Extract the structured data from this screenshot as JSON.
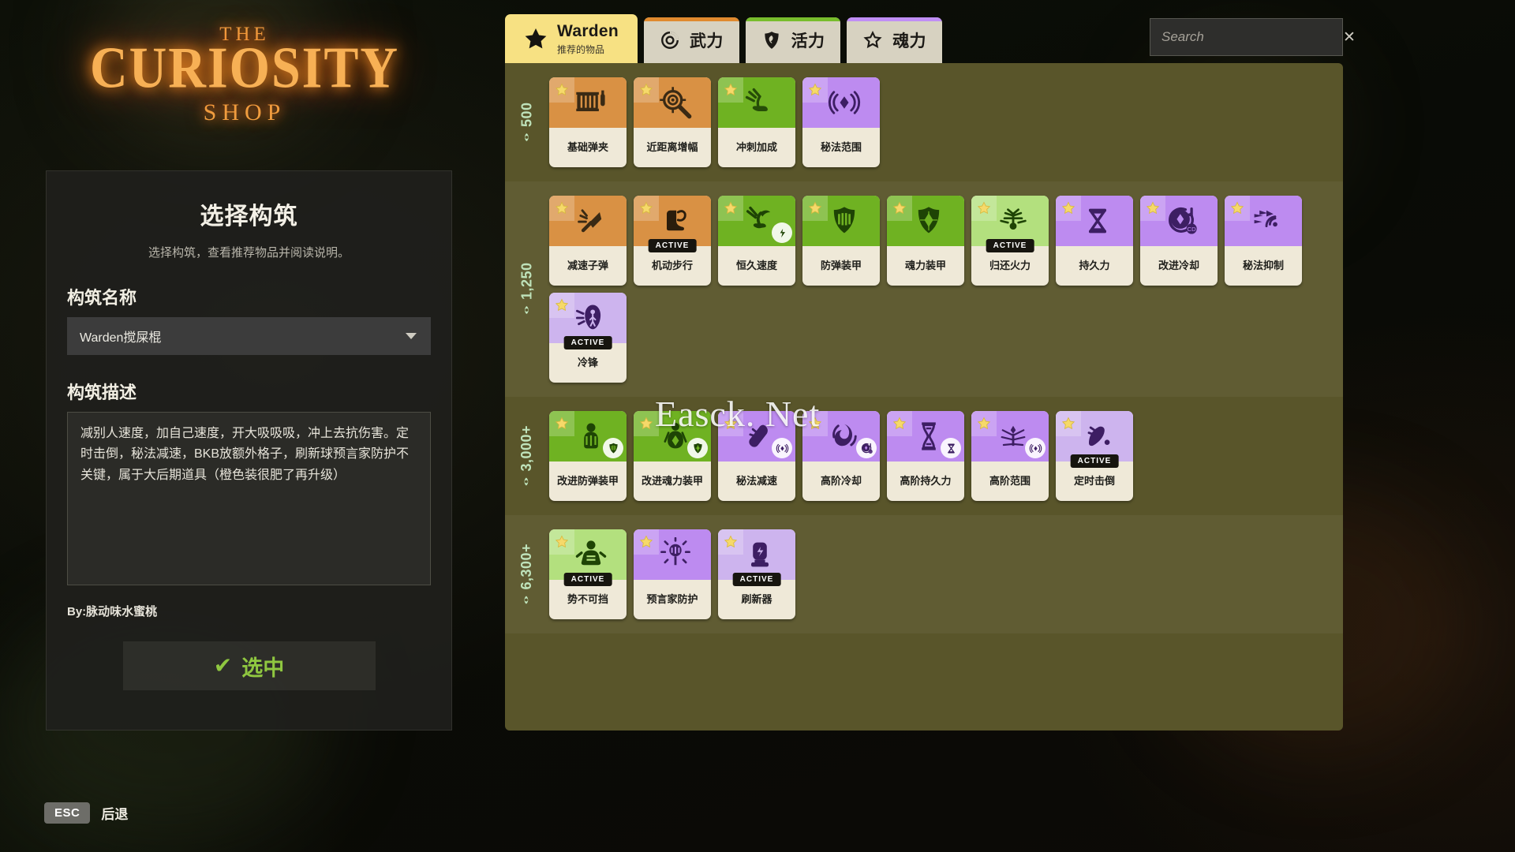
{
  "logo": {
    "top": "THE",
    "main": "CURIOSITY",
    "bottom": "SHOP"
  },
  "left_panel": {
    "title": "选择构筑",
    "subtitle": "选择构筑，查看推荐物品并阅读说明。",
    "build_name_label": "构筑名称",
    "build_name_value": "Warden搅屎棍",
    "description_label": "构筑描述",
    "description_value": "减别人速度，加自己速度，开大吸吸吸，冲上去抗伤害。定时击倒，秘法减速，BKB放额外格子，刷新球预言家防护不关键，属于大后期道具（橙色装很肥了再升级）",
    "author": "By:脉动味水蜜桃",
    "select_button": "选中"
  },
  "bottom_bar": {
    "key": "ESC",
    "label": "后退"
  },
  "search": {
    "placeholder": "Search",
    "value": "",
    "clear_label": "✕"
  },
  "tabs": [
    {
      "name": "Warden",
      "sub": "推荐的物品",
      "icon": "star-icon",
      "accent": "#f7e183",
      "selected": true
    },
    {
      "name": "武力",
      "sub": "",
      "icon": "weapon-icon",
      "accent": "#e08a2e",
      "selected": false
    },
    {
      "name": "活力",
      "sub": "",
      "icon": "vitality-shield-icon",
      "accent": "#78bd2c",
      "selected": false
    },
    {
      "name": "魂力",
      "sub": "",
      "icon": "spirit-star-icon",
      "accent": "#c08ef5",
      "selected": false
    }
  ],
  "colors": {
    "weapon": "#d99144",
    "vitality": "#6fb222",
    "spirit": "#bd8bf0",
    "panel_bg": "#59552a",
    "accent_green": "#8fc740"
  },
  "watermark": "Easck. Net",
  "tiers": [
    {
      "price": "500",
      "items": [
        {
          "name": "基础弹夹",
          "category": "weapon",
          "icon": "ammo-clip-icon",
          "active": false,
          "sub_icon": null
        },
        {
          "name": "近距离增幅",
          "category": "weapon",
          "icon": "scope-target-icon",
          "active": false,
          "sub_icon": null
        },
        {
          "name": "冲刺加成",
          "category": "vitality",
          "icon": "sprint-boot-icon",
          "active": false,
          "sub_icon": null
        },
        {
          "name": "秘法范围",
          "category": "spirit",
          "icon": "arcane-range-icon",
          "active": false,
          "sub_icon": null
        }
      ]
    },
    {
      "price": "1,250",
      "items": [
        {
          "name": "减速子弹",
          "category": "weapon",
          "icon": "slowing-bullet-icon",
          "active": false,
          "sub_icon": null
        },
        {
          "name": "机动步行",
          "category": "weapon",
          "icon": "winged-boot-icon",
          "active": true,
          "sub_icon": null
        },
        {
          "name": "恒久速度",
          "category": "vitality",
          "icon": "enduring-speed-icon",
          "active": false,
          "sub_icon": "speed-burst-icon"
        },
        {
          "name": "防弹装甲",
          "category": "vitality",
          "icon": "bullet-armor-icon",
          "active": false,
          "sub_icon": null
        },
        {
          "name": "魂力装甲",
          "category": "vitality",
          "icon": "spirit-armor-icon",
          "active": false,
          "sub_icon": null
        },
        {
          "name": "归还火力",
          "category": "vitality-light",
          "icon": "return-fire-icon",
          "active": true,
          "sub_icon": null
        },
        {
          "name": "持久力",
          "category": "spirit",
          "icon": "hourglass-icon",
          "active": false,
          "sub_icon": null
        },
        {
          "name": "改进冷却",
          "category": "spirit",
          "icon": "cooldown-icon",
          "active": false,
          "sub_icon": null
        },
        {
          "name": "秘法抑制",
          "category": "spirit",
          "icon": "arcane-suppress-icon",
          "active": false,
          "sub_icon": null
        },
        {
          "name": "冷锋",
          "category": "spirit-light",
          "icon": "cold-front-icon",
          "active": true,
          "sub_icon": null
        }
      ]
    },
    {
      "price": "3,000+",
      "items": [
        {
          "name": "改进防弹装甲",
          "category": "vitality",
          "icon": "improved-bullet-armor-icon",
          "active": false,
          "sub_icon": "bullet-armor-icon"
        },
        {
          "name": "改进魂力装甲",
          "category": "vitality",
          "icon": "improved-spirit-armor-icon",
          "active": false,
          "sub_icon": "spirit-armor-icon"
        },
        {
          "name": "秘法减速",
          "category": "spirit",
          "icon": "arcane-slow-icon",
          "active": false,
          "sub_icon": "arcane-range-icon"
        },
        {
          "name": "高阶冷却",
          "category": "spirit",
          "icon": "superior-cooldown-icon",
          "active": false,
          "sub_icon": "cooldown-icon"
        },
        {
          "name": "高阶持久力",
          "category": "spirit",
          "icon": "superior-duration-icon",
          "active": false,
          "sub_icon": "hourglass-icon"
        },
        {
          "name": "高阶范围",
          "category": "spirit",
          "icon": "superior-range-icon",
          "active": false,
          "sub_icon": "arcane-range-icon"
        },
        {
          "name": "定时击倒",
          "category": "spirit-light",
          "icon": "knockdown-icon",
          "active": true,
          "sub_icon": null
        }
      ]
    },
    {
      "price": "6,300+",
      "items": [
        {
          "name": "势不可挡",
          "category": "vitality-light",
          "icon": "unstoppable-icon",
          "active": true,
          "sub_icon": null
        },
        {
          "name": "预言家防护",
          "category": "spirit",
          "icon": "diviners-kevlar-icon",
          "active": false,
          "sub_icon": null
        },
        {
          "name": "刷新器",
          "category": "spirit-light",
          "icon": "refresher-icon",
          "active": true,
          "sub_icon": null
        }
      ]
    }
  ]
}
